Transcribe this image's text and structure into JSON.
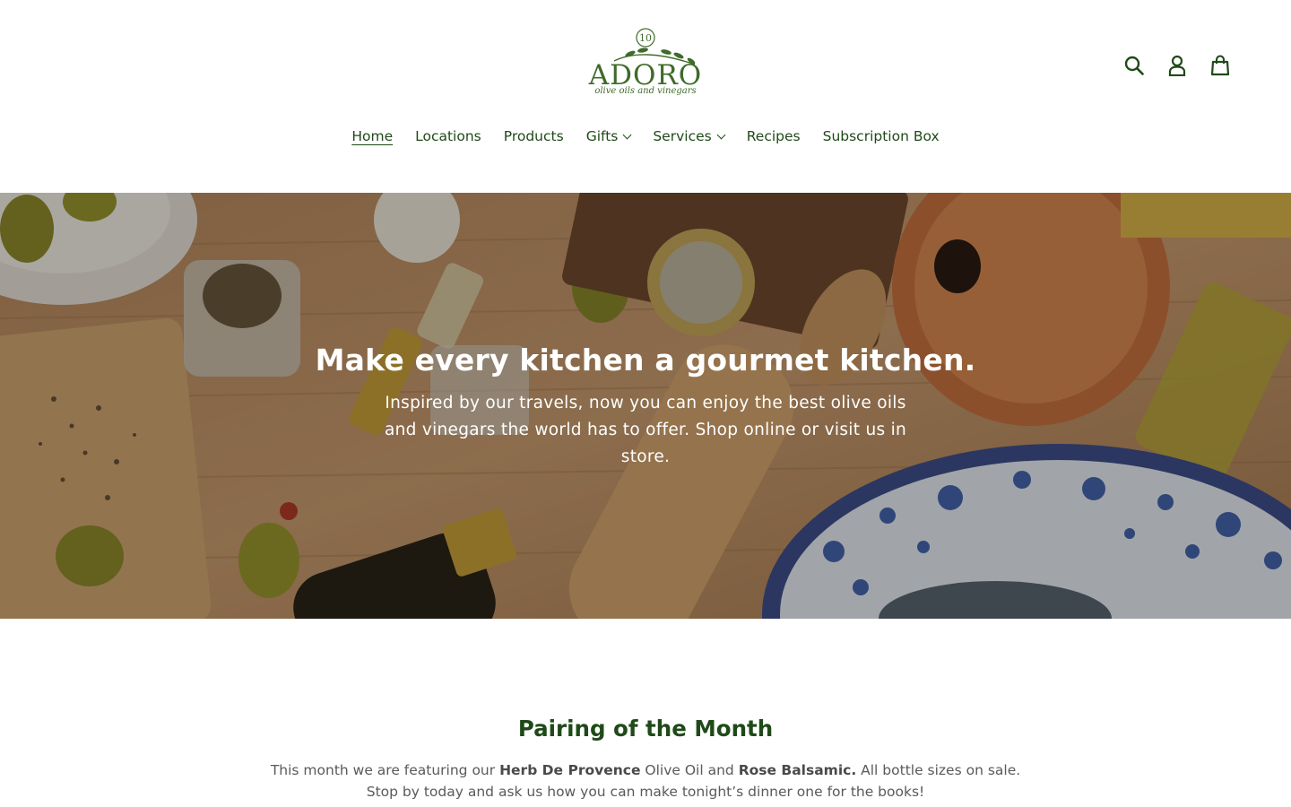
{
  "brand": {
    "name": "ADORO",
    "tagline": "olive oils and vinegars",
    "badge": "10"
  },
  "header": {
    "icons": [
      "search-icon",
      "account-icon",
      "cart-icon"
    ]
  },
  "nav": {
    "items": [
      {
        "label": "Home",
        "active": true,
        "dropdown": false
      },
      {
        "label": "Locations",
        "active": false,
        "dropdown": false
      },
      {
        "label": "Products",
        "active": false,
        "dropdown": false
      },
      {
        "label": "Gifts",
        "active": false,
        "dropdown": true
      },
      {
        "label": "Services",
        "active": false,
        "dropdown": true
      },
      {
        "label": "Recipes",
        "active": false,
        "dropdown": false
      },
      {
        "label": "Subscription Box",
        "active": false,
        "dropdown": false
      }
    ]
  },
  "hero": {
    "title": "Make every kitchen a gourmet kitchen.",
    "subtitle": "Inspired by our travels, now you can enjoy the best olive oils and vinegars the world has to offer. Shop online or visit us in store."
  },
  "pairing": {
    "title": "Pairing of the Month",
    "line1_pre": "This month we are featuring our ",
    "line1_bold1": "Herb De Provence",
    "line1_mid": " Olive Oil and ",
    "line1_bold2": "Rose Balsamic.",
    "line1_post": " All bottle sizes on sale.",
    "line2": "Stop by today and ask us how you can make tonight’s dinner one for the books!"
  },
  "colors": {
    "brand_green": "#1f4a18",
    "logo_green": "#3f6b2a",
    "text_gray": "#5a5a5a"
  }
}
